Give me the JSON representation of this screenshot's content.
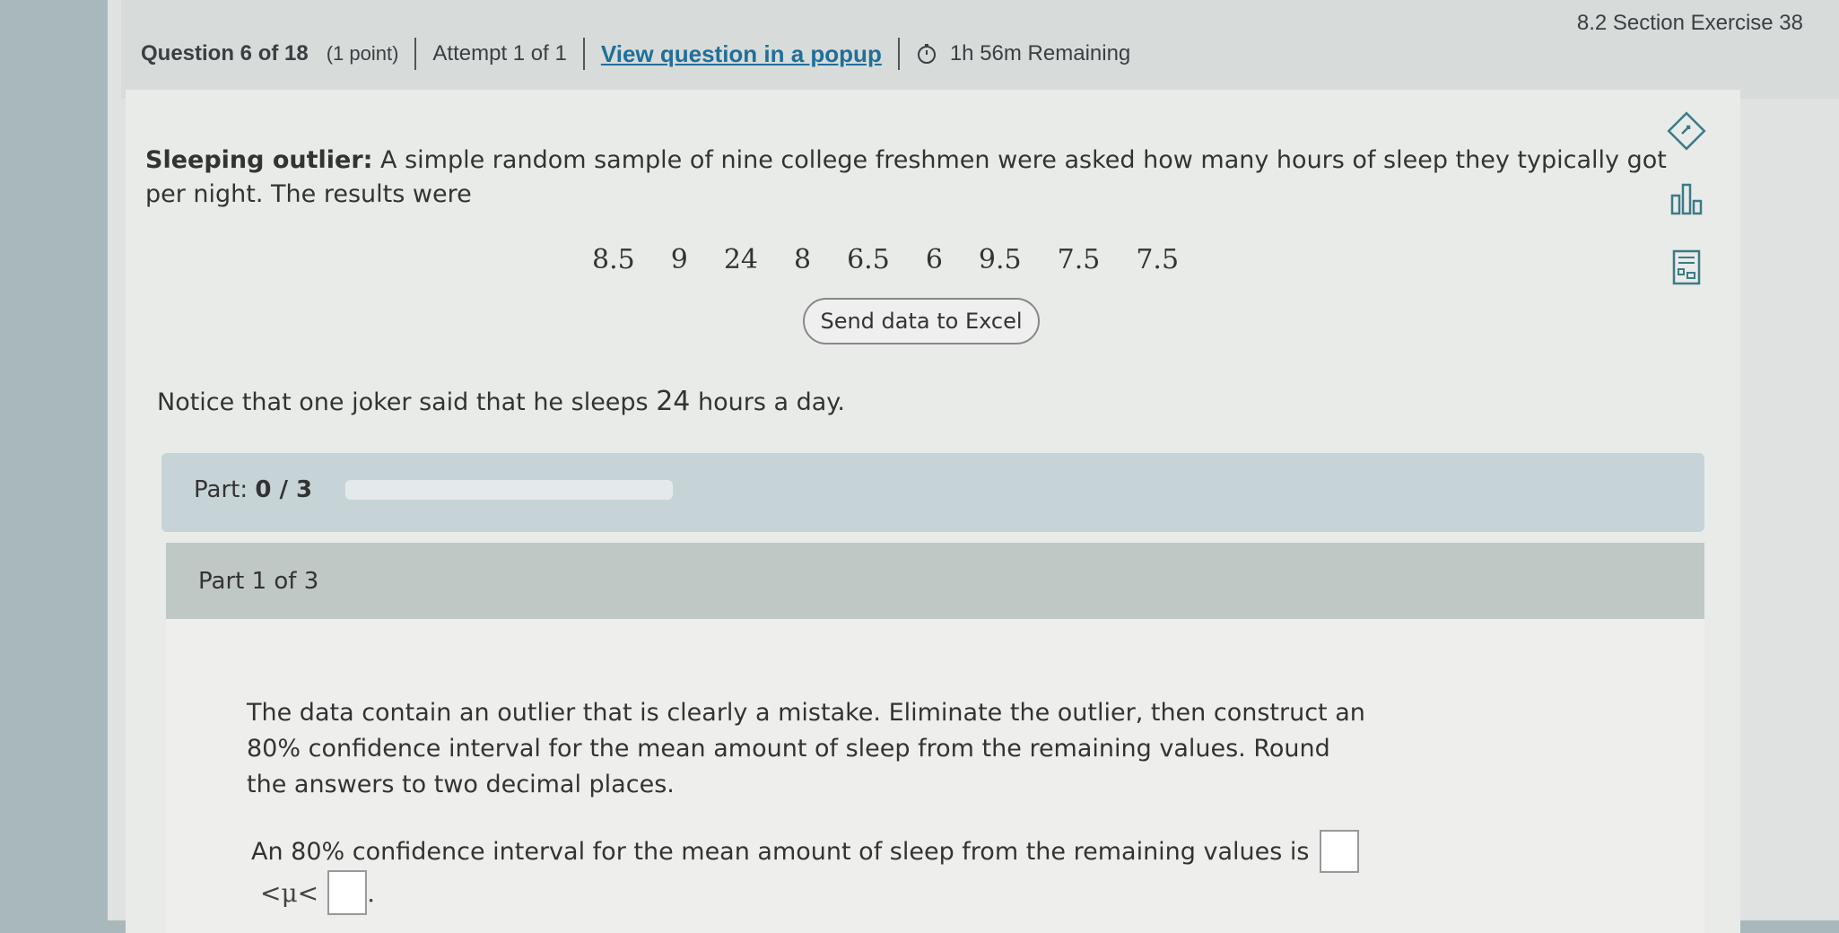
{
  "header": {
    "question": "Question 6 of 18",
    "points": "(1 point)",
    "attempt": "Attempt 1 of 1",
    "popup_link": "View question in a popup",
    "timer": "1h 56m Remaining",
    "section": "8.2 Section Exercise 38"
  },
  "problem": {
    "title": "Sleeping outlier:",
    "text": " A simple random sample of nine college freshmen were asked how many hours of sleep they typically got per night. The results were",
    "values": [
      "8.5",
      "9",
      "24",
      "8",
      "6.5",
      "6",
      "9.5",
      "7.5",
      "7.5"
    ],
    "excel_button": "Send data to Excel",
    "notice_before": "Notice that one joker said that he sleeps ",
    "notice_num": "24",
    "notice_after": " hours a day."
  },
  "progress": {
    "label": "Part: ",
    "value": "0 / 3",
    "fraction": 0
  },
  "part": {
    "heading": "Part 1 of 3",
    "instructions": "The data contain an outlier that is clearly a mistake. Eliminate the outlier, then construct an 80% confidence interval for the mean amount of sleep from the remaining values. Round the answers to two decimal places.",
    "answer_prefix": "An 80% confidence interval for the mean amount of sleep from the remaining values is",
    "mu_text": "<μ<",
    "period": "."
  },
  "icons": {
    "timer": "clock-icon",
    "tools": [
      "eraser-icon",
      "bar-chart-icon",
      "calculator-icon"
    ]
  }
}
